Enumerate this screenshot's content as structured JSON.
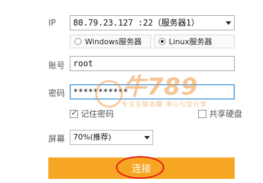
{
  "form": {
    "ip_label": "IP",
    "ip_value": "80.79.23.127 :22（服务器1）",
    "server_type": {
      "options": [
        "Windows服务器",
        "Linux服务器"
      ],
      "selected": "Linux服务器"
    },
    "account_label": "账号",
    "account_value": "root",
    "password_label": "密码",
    "password_value": "***********",
    "remember_label": "记住密码",
    "remember_checked": true,
    "share_disk_label": "共享硬盘",
    "share_disk_checked": false,
    "screen_label": "屏幕",
    "screen_value": "70%(推荐)",
    "connect_label": "连接"
  },
  "watermark": {
    "brand": "牛789",
    "slogan": "专注互联收藏  用心与您分享"
  },
  "colors": {
    "accent": "#f6a623",
    "highlight": "#e51a1a"
  }
}
